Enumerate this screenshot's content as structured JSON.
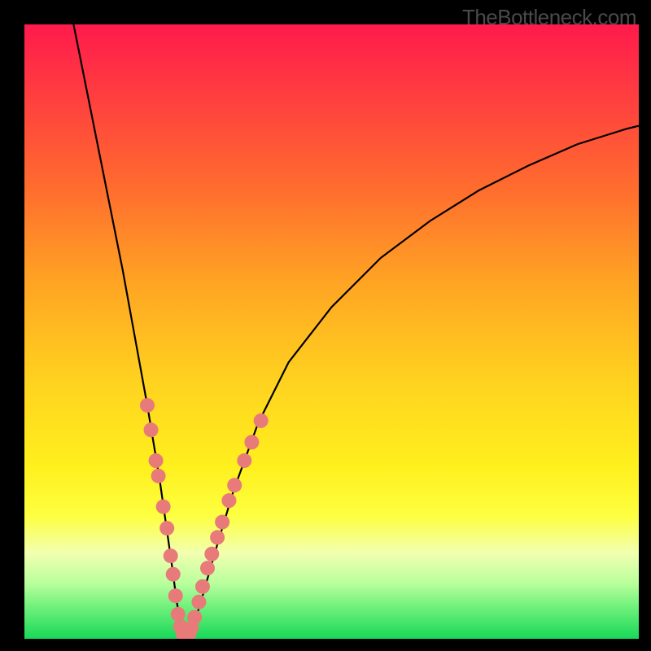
{
  "watermark": "TheBottleneck.com",
  "chart_data": {
    "type": "line",
    "title": "",
    "xlabel": "",
    "ylabel": "",
    "xlim": [
      0,
      100
    ],
    "ylim": [
      0,
      100
    ],
    "series": [
      {
        "name": "bottleneck-curve",
        "x": [
          8,
          10,
          12,
          14,
          16,
          18,
          20,
          22,
          23,
          24,
          24.8,
          25.5,
          26.3,
          27.5,
          29,
          31,
          34,
          38,
          43,
          50,
          58,
          66,
          74,
          82,
          90,
          98,
          100
        ],
        "values": [
          100,
          90,
          80,
          70,
          60,
          49,
          38,
          26,
          19,
          12,
          6,
          2,
          0.5,
          2,
          7,
          14,
          24,
          35,
          45,
          54,
          62,
          68,
          73,
          77,
          80.5,
          83,
          83.5
        ]
      }
    ],
    "markers": {
      "name": "highlight-dots",
      "color": "#e97a7a",
      "points": [
        {
          "x": 20.0,
          "y": 38.0
        },
        {
          "x": 20.6,
          "y": 34.0
        },
        {
          "x": 21.4,
          "y": 29.0
        },
        {
          "x": 21.8,
          "y": 26.5
        },
        {
          "x": 22.6,
          "y": 21.5
        },
        {
          "x": 23.2,
          "y": 18.0
        },
        {
          "x": 23.8,
          "y": 13.5
        },
        {
          "x": 24.2,
          "y": 10.5
        },
        {
          "x": 24.6,
          "y": 7.0
        },
        {
          "x": 25.0,
          "y": 4.0
        },
        {
          "x": 25.4,
          "y": 2.0
        },
        {
          "x": 25.8,
          "y": 0.8
        },
        {
          "x": 26.3,
          "y": 0.5
        },
        {
          "x": 26.8,
          "y": 0.8
        },
        {
          "x": 27.2,
          "y": 1.8
        },
        {
          "x": 27.7,
          "y": 3.5
        },
        {
          "x": 28.4,
          "y": 6.0
        },
        {
          "x": 29.0,
          "y": 8.5
        },
        {
          "x": 29.8,
          "y": 11.5
        },
        {
          "x": 30.5,
          "y": 13.8
        },
        {
          "x": 31.4,
          "y": 16.5
        },
        {
          "x": 32.2,
          "y": 19.0
        },
        {
          "x": 33.3,
          "y": 22.5
        },
        {
          "x": 34.2,
          "y": 25.0
        },
        {
          "x": 35.8,
          "y": 29.0
        },
        {
          "x": 37.0,
          "y": 32.0
        },
        {
          "x": 38.5,
          "y": 35.5
        }
      ]
    }
  }
}
